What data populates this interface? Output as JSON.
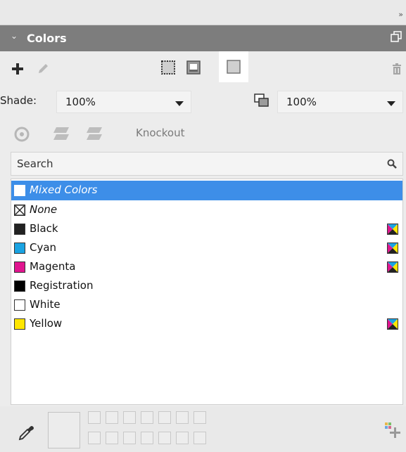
{
  "panel": {
    "title": "Colors",
    "collapse_glyph": "»"
  },
  "toolbar": {
    "icons": [
      "add-icon",
      "edit-icon",
      "frame-icon",
      "stroke-icon",
      "fill-icon",
      "trash-icon"
    ]
  },
  "shade": {
    "label": "Shade:",
    "value": "100%"
  },
  "opacity": {
    "value": "100%"
  },
  "knockout": {
    "label": "Knockout"
  },
  "search": {
    "placeholder": "Search"
  },
  "colors": [
    {
      "name": "Mixed Colors",
      "swatch": "#ffffff",
      "selected": true,
      "italic": true,
      "cmyk": false
    },
    {
      "name": "None",
      "swatch": "none",
      "selected": false,
      "italic": true,
      "cmyk": false
    },
    {
      "name": "Black",
      "swatch": "#222222",
      "selected": false,
      "italic": false,
      "cmyk": true
    },
    {
      "name": "Cyan",
      "swatch": "#1aa3e2",
      "selected": false,
      "italic": false,
      "cmyk": true
    },
    {
      "name": "Magenta",
      "swatch": "#e0158f",
      "selected": false,
      "italic": false,
      "cmyk": true
    },
    {
      "name": "Registration",
      "swatch": "#000000",
      "selected": false,
      "italic": false,
      "cmyk": false
    },
    {
      "name": "White",
      "swatch": "#ffffff",
      "selected": false,
      "italic": false,
      "cmyk": false
    },
    {
      "name": "Yellow",
      "swatch": "#ffe600",
      "selected": false,
      "italic": false,
      "cmyk": true
    }
  ],
  "accent": "#3d8ee8"
}
